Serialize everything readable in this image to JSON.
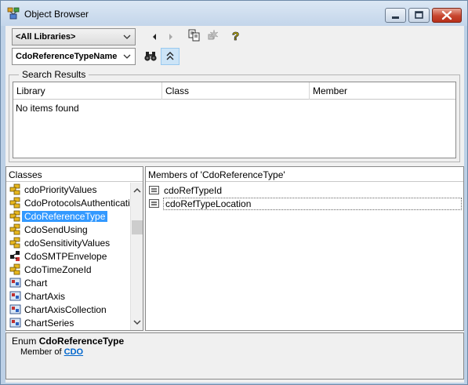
{
  "window": {
    "title": "Object Browser"
  },
  "toolbar": {
    "library_value": "<All Libraries>",
    "search_value": "CdoReferenceTypeName",
    "icons": [
      "back-arrow-icon",
      "forward-arrow-icon",
      "copy-icon",
      "view-definition-icon",
      "help-icon",
      "search-binoculars-icon",
      "toggle-search-results-icon"
    ]
  },
  "search_results": {
    "label": "Search Results",
    "columns": [
      "Library",
      "Class",
      "Member"
    ],
    "empty_text": "No items found"
  },
  "classes": {
    "header": "Classes",
    "items": [
      {
        "label": "cdoPriorityValues",
        "icon": "enum-icon",
        "selected": false
      },
      {
        "label": "CdoProtocolsAuthentication",
        "icon": "enum-icon",
        "selected": false
      },
      {
        "label": "CdoReferenceType",
        "icon": "enum-icon",
        "selected": true
      },
      {
        "label": "CdoSendUsing",
        "icon": "enum-icon",
        "selected": false
      },
      {
        "label": "cdoSensitivityValues",
        "icon": "enum-icon",
        "selected": false
      },
      {
        "label": "CdoSMTPEnvelope",
        "icon": "module-icon",
        "selected": false
      },
      {
        "label": "CdoTimeZoneId",
        "icon": "enum-icon",
        "selected": false
      },
      {
        "label": "Chart",
        "icon": "class-icon",
        "selected": false
      },
      {
        "label": "ChartAxis",
        "icon": "class-icon",
        "selected": false
      },
      {
        "label": "ChartAxisCollection",
        "icon": "class-icon",
        "selected": false
      },
      {
        "label": "ChartSeries",
        "icon": "class-icon",
        "selected": false
      }
    ]
  },
  "members": {
    "header": "Members of 'CdoReferenceType'",
    "items": [
      {
        "label": "cdoRefTypeId",
        "icon": "constant-icon",
        "focused": false
      },
      {
        "label": "cdoRefTypeLocation",
        "icon": "constant-icon",
        "focused": true
      }
    ]
  },
  "details": {
    "kind": "Enum",
    "name": "CdoReferenceType",
    "member_of_prefix": "Member of",
    "member_of_link": "CDO"
  }
}
